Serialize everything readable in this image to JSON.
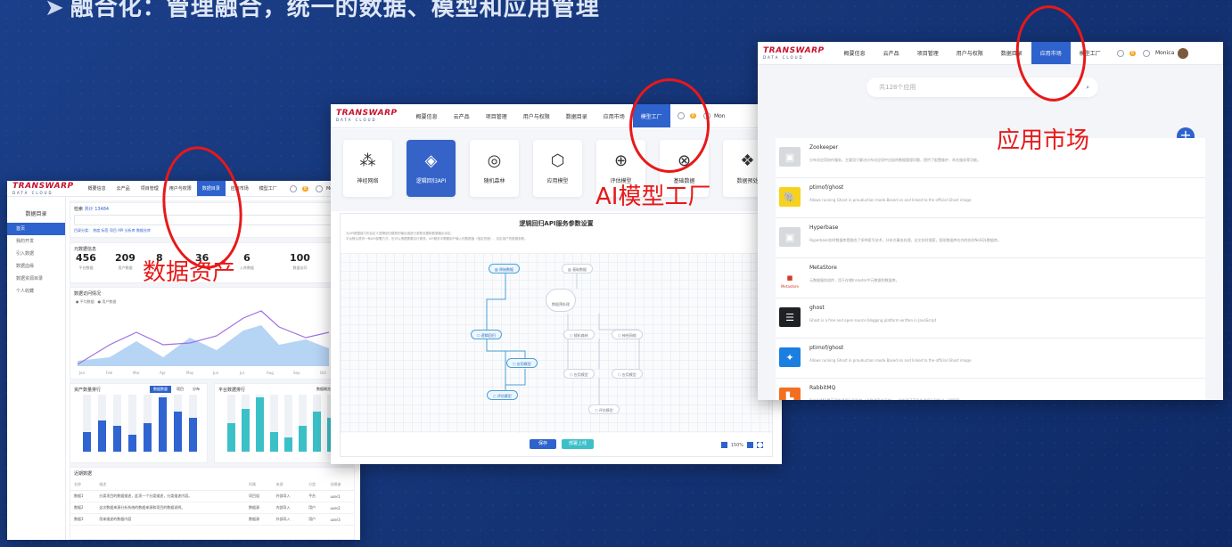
{
  "slide": {
    "title": "融合化：管理融合，统一的数据、模型和应用管理",
    "arrow": "➤"
  },
  "brand": {
    "logo": "TRANSWARP",
    "sub": "DATA CLOUD"
  },
  "shot1": {
    "nav": [
      "概要信息",
      "云产品",
      "项目管理",
      "用户与权限",
      "数据目录",
      "应用市场",
      "模型工厂"
    ],
    "active_nav": "数据目录",
    "user": "Mo",
    "sidebar_title": "数据目录",
    "sidebar_items": [
      "首页",
      "我的开发",
      "引入数据",
      "数据血缘",
      "数据资源目录",
      "个人收藏"
    ],
    "search_label": "检索",
    "search_hint": "共计 13484",
    "filter_row": "目录分类： 热度  标签  项目  API  分析库  数据仓库",
    "overview_title": "元数据信息",
    "stats": [
      {
        "value": "456",
        "label": "平台数据"
      },
      {
        "value": "209",
        "label": "用户数据"
      },
      {
        "value": "8",
        "label": ""
      },
      {
        "value": "36",
        "label": ""
      },
      {
        "value": "6",
        "label": "入库数据"
      },
      {
        "value": "100",
        "label": "数据访问"
      }
    ],
    "trend_title": "数据访问情况",
    "trend_legend": [
      "平均数据",
      "用户数据"
    ],
    "months": [
      "Jan",
      "Feb",
      "Mar",
      "Apr",
      "May",
      "Jun",
      "Jul",
      "Aug",
      "Sep",
      "Oct"
    ],
    "bar1_title": "资产数量排行",
    "bar1_tabs": [
      "数据数量",
      "项目",
      "分布"
    ],
    "bar2_title": "平台数据排行",
    "bar2_tabs": [
      "数据概览",
      "项目"
    ],
    "bar1_values": [
      0.35,
      0.55,
      0.45,
      0.3,
      0.5,
      0.95,
      0.7,
      0.6
    ],
    "bar2_values": [
      0.5,
      0.75,
      0.95,
      0.35,
      0.25,
      0.45,
      0.7,
      0.6
    ],
    "recent_title": "近期数据",
    "recent_headers": [
      "名称",
      "描述",
      "所属",
      "来源",
      "分类",
      "创建者"
    ],
    "recent_rows": [
      [
        "数据1",
        "分类项目的数据描述，此项一个分类描述，分类描述内容。",
        "项目组",
        "外部导入",
        "平台",
        "user1"
      ],
      [
        "数据2",
        "这次数据来源分析系统的数据来源和项目的数据说明。",
        "数据源",
        "内部导入",
        "用户",
        "user2"
      ],
      [
        "数据3",
        "用来描述的数据内容",
        "数据源",
        "外部导入",
        "用户",
        "user3"
      ]
    ]
  },
  "shot2": {
    "nav": [
      "概要信息",
      "云产品",
      "项目管理",
      "用户与权限",
      "数据目录",
      "应用市场",
      "模型工厂"
    ],
    "active_nav": "模型工厂",
    "user": "Mon",
    "tiles": [
      {
        "label": "神经网络",
        "icon": "neural-network-icon",
        "glyph": "⁂"
      },
      {
        "label": "逻辑回归API",
        "icon": "layers-icon",
        "glyph": "◈"
      },
      {
        "label": "随机森林",
        "icon": "mask-icon",
        "glyph": "◎"
      },
      {
        "label": "应用模型",
        "icon": "cube-icon",
        "glyph": "⬡"
      },
      {
        "label": "评估模型",
        "icon": "globe-icon",
        "glyph": "⊕"
      },
      {
        "label": "基础数据",
        "icon": "world-icon",
        "glyph": "⊗"
      },
      {
        "label": "数据预处",
        "icon": "cubes-icon",
        "glyph": "❖"
      }
    ],
    "active_tile": 1,
    "panel_title": "逻辑回归API服务参数设置",
    "panel_desc": "为API数据接口的自定义逻辑回归模型的输出值进行参数设置和数据输出设定。",
    "panel_desc2": "平台默认提供一种API部署方式，也可以根据需要自行更改。API服务中需要用户输入的数据值（指定的值）、自定用户的数据参数。",
    "nodes": [
      "原始数据",
      "基础数据",
      "数据预处理",
      "逻辑回归",
      "随机森林",
      "神经网络",
      "应用模型",
      "应用模型",
      "应用模型",
      "评估模型",
      "评估模型"
    ],
    "save_btn": "保存",
    "publish_btn": "部署上线",
    "zoom": "150%"
  },
  "shot3": {
    "nav": [
      "概要信息",
      "云产品",
      "项目管理",
      "用户与权限",
      "数据目录",
      "应用市场",
      "模型工厂"
    ],
    "active_nav": "应用市场",
    "user": "Monica",
    "notif": "8",
    "search_placeholder": "共128个应用",
    "apps": [
      {
        "name": "Zookeeper",
        "desc": "分布式应用协作服务，主要用于解决分布式应用中出现的数据管理问题，提供了配置维护、命名服务等功能。",
        "icon": "zookeeper-icon",
        "color": "#d7d9de",
        "glyph": "▣"
      },
      {
        "name": "ptimof/ghost",
        "desc": "Allows running Ghost in prouduction mode.Based on and linked to the official Ghost image",
        "icon": "hadoop-elephant-icon",
        "color": "#f7d21c",
        "glyph": "🐘"
      },
      {
        "name": "Hyperbase",
        "desc": "Hyperbase实时数据库是融合了多种索引技术，分布式事务处理，全文实时搜索，图形数据库在内的实时NoSQL数据库。",
        "icon": "hyperbase-icon",
        "color": "#d7d9de",
        "glyph": "▣"
      },
      {
        "name": "MetaStore",
        "desc": "元数据服务组件，用于存储Inceptor中元数据的数据库。",
        "icon": "metastore-icon",
        "color": "#ffffff",
        "glyph": "▪"
      },
      {
        "name": "ghost",
        "desc": "Ghost is a free and open source blogging platform written in JavaScript",
        "icon": "ghost-icon",
        "color": "#1f2124",
        "glyph": "☰"
      },
      {
        "name": "ptimof/ghost",
        "desc": "Allows running Ghost in prouduction mode.Based on and linked to the official Ghost image",
        "icon": "hedgehog-icon",
        "color": "#1b7fe0",
        "glyph": "✦"
      },
      {
        "name": "RabbitMQ",
        "desc": "RabbitMQ是开源的消息队列系统（或称消息中间件），它实现了高级的消息队列协议（AMQP）。",
        "icon": "rabbitmq-icon",
        "color": "#f26f21",
        "glyph": "▙"
      }
    ],
    "metastore_label": "Metastore"
  },
  "callouts": {
    "data_asset": "数据资产",
    "ai_factory": "AI模型工厂",
    "app_market": "应用市场"
  }
}
